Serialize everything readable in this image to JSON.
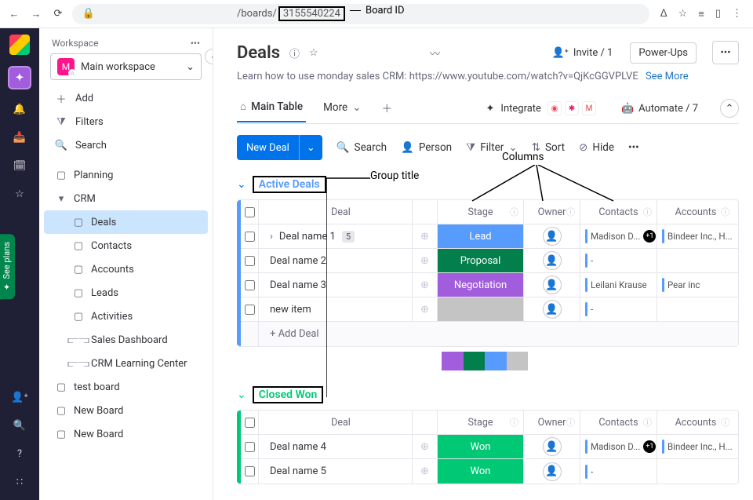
{
  "chrome": {
    "url_prefix": "/boards/",
    "board_id": "3155540224",
    "board_id_label": "Board ID"
  },
  "sidebar": {
    "workspace_label": "Workspace",
    "workspace_name": "Main workspace",
    "actions": {
      "add": "Add",
      "filters": "Filters",
      "search": "Search"
    },
    "tree": {
      "planning": "Planning",
      "crm": "CRM",
      "crm_children": [
        "Deals",
        "Contacts",
        "Accounts",
        "Leads",
        "Activities",
        "Sales Dashboard",
        "CRM Learning Center"
      ],
      "active_index": 0,
      "other_boards": [
        "test board",
        "New Board",
        "New Board"
      ]
    },
    "see_plans": "See plans"
  },
  "header": {
    "title": "Deals",
    "invite": "Invite / 1",
    "powerups": "Power-Ups",
    "description": "Learn how to use monday sales CRM: https://www.youtube.com/watch?v=QjKcGGVPLVE",
    "see_more": "See More"
  },
  "tabs": {
    "main": "Main Table",
    "more": "More",
    "integrate": "Integrate",
    "automate": "Automate / 7"
  },
  "toolbar": {
    "new_deal": "New Deal",
    "search": "Search",
    "person": "Person",
    "filter": "Filter",
    "sort": "Sort",
    "hide": "Hide"
  },
  "columns": {
    "deal": "Deal",
    "stage": "Stage",
    "owner": "Owner",
    "contacts": "Contacts",
    "accounts": "Accounts"
  },
  "annotations": {
    "columns": "Columns",
    "group_title": "Group title"
  },
  "groups": [
    {
      "title": "Active Deals",
      "color": "blue",
      "rows": [
        {
          "name": "Deal name 1",
          "expandable": true,
          "count": 5,
          "stage": "Lead",
          "stage_class": "lead",
          "contacts": "Madison D...",
          "contacts_plus": "+1",
          "accounts": "Bindeer Inc., H...",
          "contact_color": "#579bfc",
          "account_color": "#579bfc"
        },
        {
          "name": "Deal name 2",
          "stage": "Proposal",
          "stage_class": "proposal",
          "contacts": "-",
          "contact_color": "#579bfc"
        },
        {
          "name": "Deal name 3",
          "stage": "Negotiation",
          "stage_class": "negotiation",
          "contacts": "Leilani Krause",
          "accounts": "Pear inc",
          "contact_color": "#579bfc",
          "account_color": "#579bfc"
        },
        {
          "name": "new item",
          "stage": "",
          "stage_class": "blank-gray",
          "contacts": "-",
          "contact_color": "#579bfc"
        }
      ],
      "add_label": "+ Add Deal",
      "summary": [
        {
          "color": "#a25ddc",
          "flex": 1
        },
        {
          "color": "#037f4c",
          "flex": 1
        },
        {
          "color": "#579bfc",
          "flex": 1
        },
        {
          "color": "#c4c4c4",
          "flex": 1
        }
      ]
    },
    {
      "title": "Closed Won",
      "color": "green",
      "rows": [
        {
          "name": "Deal name 4",
          "stage": "Won",
          "stage_class": "won",
          "contacts": "Madison D...",
          "contacts_plus": "+1",
          "accounts": "Bindeer Inc., H...",
          "contact_color": "#579bfc",
          "account_color": "#579bfc"
        },
        {
          "name": "Deal name 5",
          "stage": "Won",
          "stage_class": "won",
          "contacts": "-",
          "contact_color": "#579bfc"
        }
      ]
    }
  ],
  "icons": {
    "ws_letter": "M"
  }
}
